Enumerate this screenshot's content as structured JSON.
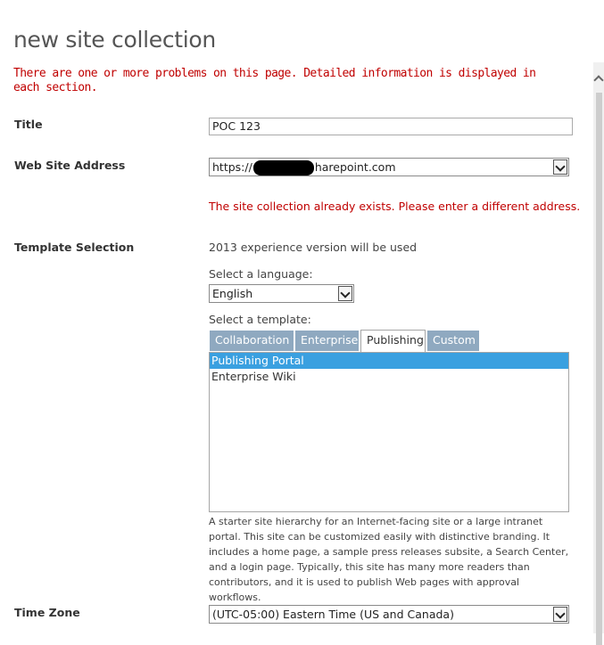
{
  "page": {
    "title": "new site collection"
  },
  "error_banner": "There are one or more problems on this page. Detailed information is displayed in each section.",
  "title_field": {
    "label": "Title",
    "value": "POC 123"
  },
  "address_field": {
    "label": "Web Site Address",
    "value_prefix": "https://",
    "value_suffix": "harepoint.com",
    "error": "The site collection already exists. Please enter a different address."
  },
  "template_selection": {
    "label": "Template Selection",
    "experience_note": "2013 experience version will be used",
    "language_label": "Select a language:",
    "language_value": "English",
    "template_label": "Select a template:",
    "tabs": [
      {
        "label": "Collaboration",
        "active": false
      },
      {
        "label": "Enterprise",
        "active": false
      },
      {
        "label": "Publishing",
        "active": true
      },
      {
        "label": "Custom",
        "active": false
      }
    ],
    "templates": [
      {
        "label": "Publishing Portal",
        "selected": true
      },
      {
        "label": "Enterprise Wiki",
        "selected": false
      }
    ],
    "description": "A starter site hierarchy for an Internet-facing site or a large intranet portal. This site can be customized easily with distinctive branding. It includes a home page, a sample press releases subsite, a Search Center, and a login page. Typically, this site has many more readers than contributors, and it is used to publish Web pages with approval workflows."
  },
  "time_zone": {
    "label": "Time Zone",
    "value": "(UTC-05:00) Eastern Time (US and Canada)"
  },
  "colors": {
    "error": "#c00000",
    "tab_inactive": "#8fa9c0",
    "selection": "#3aa0e0"
  }
}
